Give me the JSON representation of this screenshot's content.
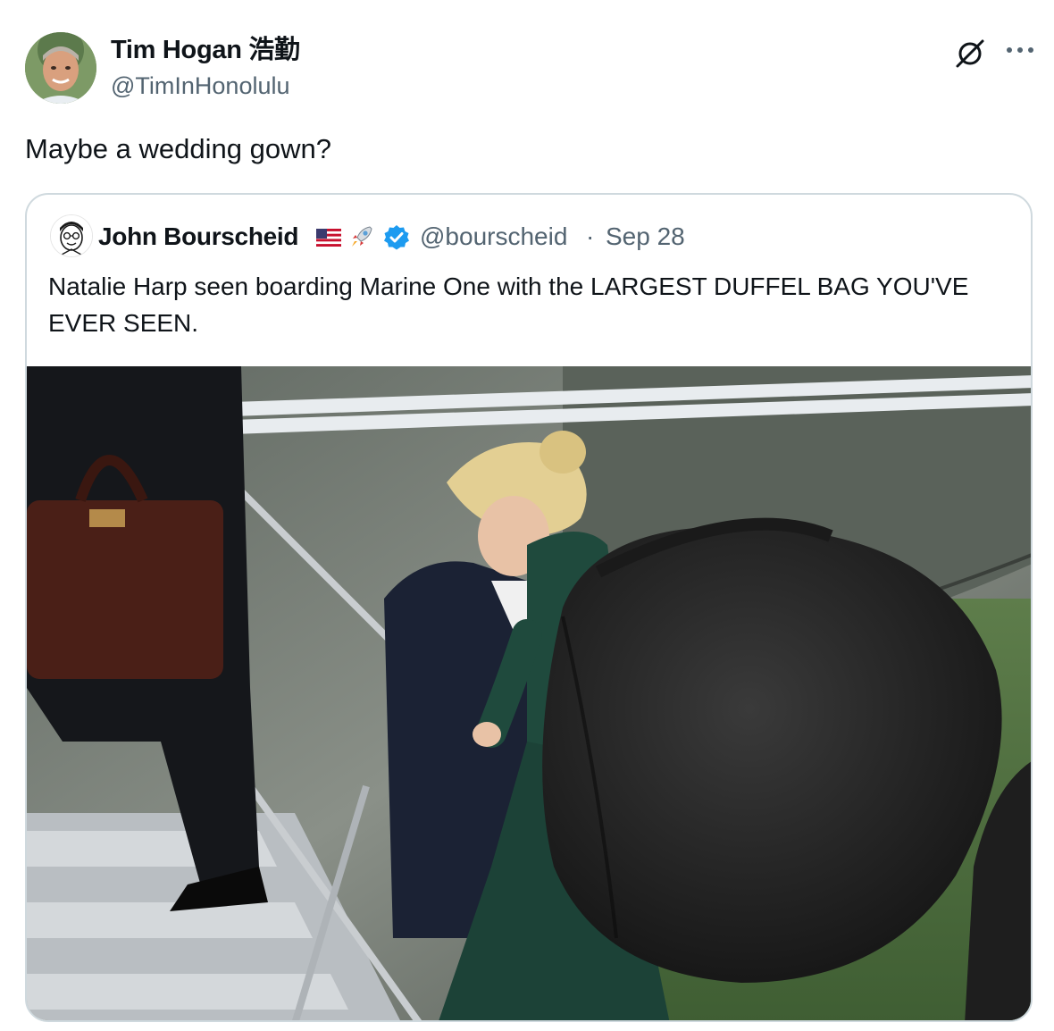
{
  "author": {
    "display_name": "Tim Hogan 浩勤",
    "handle": "@TimInHonolulu",
    "avatar_icon": "profile-photo"
  },
  "tweet": {
    "text": "Maybe a wedding gown?"
  },
  "actions": {
    "grok_icon": "grok-icon",
    "more_icon": "more-icon"
  },
  "quoted": {
    "display_name": "John Bourscheid",
    "emojis": [
      "us-flag-emoji",
      "rocket-emoji"
    ],
    "verified_icon": "verified-badge-icon",
    "handle": "@bourscheid",
    "separator": "·",
    "date": "Sep 28",
    "text": "Natalie Harp seen boarding Marine One with the LARGEST DUFFEL BAG YOU'VE EVER SEEN.",
    "photo": "photo of a woman carrying a huge black duffel bag up aircraft stairs"
  },
  "colors": {
    "text_primary": "#0f1419",
    "text_secondary": "#536471",
    "border": "#cfd9de",
    "verified_blue": "#1d9bf0"
  }
}
